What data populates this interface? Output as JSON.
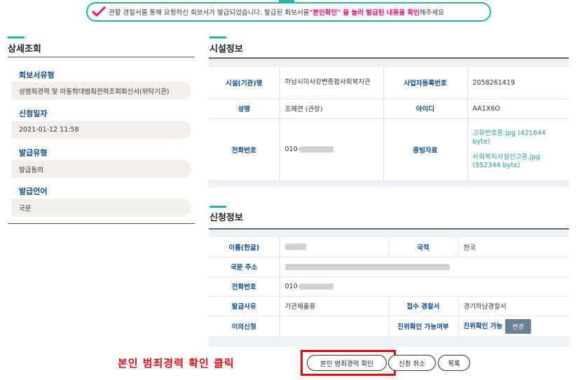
{
  "notice": {
    "text_before": "관할 경찰서를 통해 요청하신 회보서가 발급되었습니다. 발급된 회보서를 ",
    "highlight": "\"본인확인\" 을 눌러 발급된 내용을 확인",
    "text_after": "해주세요"
  },
  "sidebar": {
    "title": "상세조회",
    "items": [
      {
        "label": "회보서유형",
        "value": "성범죄경력 및 아동학대범죄전력조회회신서(위탁기관)"
      },
      {
        "label": "신청일자",
        "value": "2021-01-12 11:58"
      },
      {
        "label": "발급유형",
        "value": "발급동의"
      },
      {
        "label": "발급언어",
        "value": "국문"
      }
    ]
  },
  "facility": {
    "title": "시설정보",
    "name_label": "시설(기관)명",
    "name_value": "하남시미사강변종합사회복지관",
    "bizno_label": "사업자등록번호",
    "bizno_value": "2058261419",
    "person_label": "성명",
    "person_value": "조혜연 (관장)",
    "id_label": "아이디",
    "id_value": "AA1X6O",
    "phone_label": "전화번호",
    "phone_prefix": "010-",
    "proof_label": "증빙자료",
    "files": [
      "고유번호증.jpg (421644 byte)",
      "사회복지시설신고증.jpg (552344 byte)"
    ]
  },
  "application": {
    "title": "신청정보",
    "name_label": "이름(한글)",
    "nation_label": "국적",
    "nation_value": "한국",
    "address_label": "국문 주소",
    "phone_label": "전화번호",
    "phone_prefix": "010-",
    "reason_label": "발급사유",
    "reason_value": "기관제출용",
    "station_label": "접수 경찰서",
    "station_value": "경기하남경찰서",
    "objection_label": "이의신청",
    "verify_label": "진위확인 가능여부",
    "verify_value": "진위확인 가능",
    "change_label": "변경"
  },
  "annotation": "본인 범죄경력 확인 클릭",
  "buttons": {
    "confirm": "본인 범죄경력 확인",
    "cancel": "신청 취소",
    "list": "목록"
  },
  "colors": {
    "accent": "#2bb3a3",
    "label_blue": "#0b4a8c",
    "highlight": "#e4106f",
    "annotation_red": "#e50914"
  }
}
